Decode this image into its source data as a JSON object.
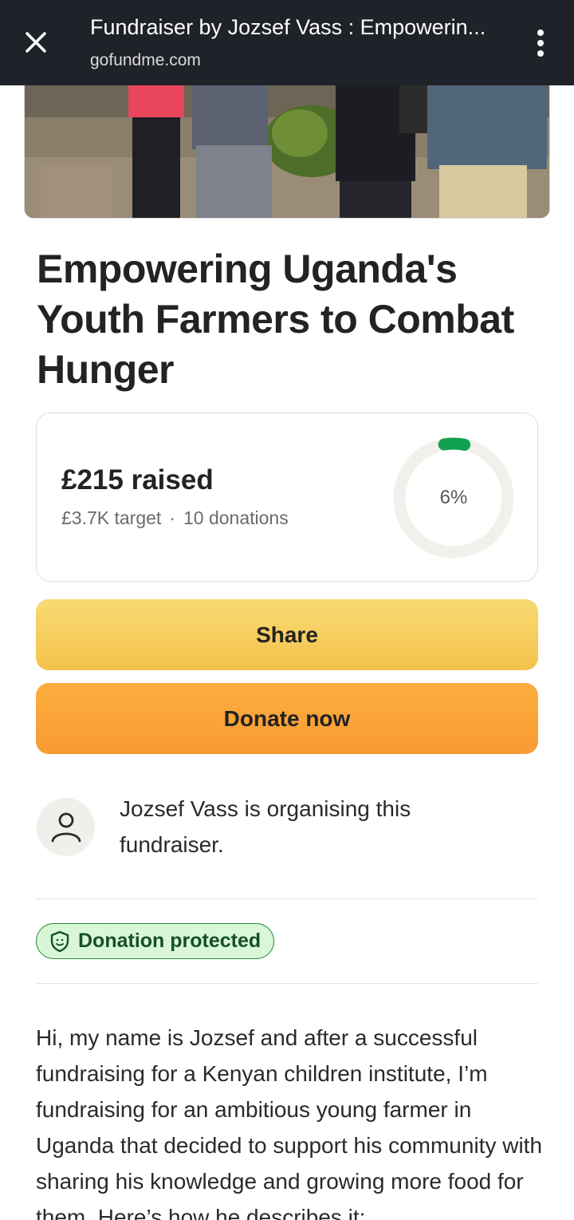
{
  "browser": {
    "title": "Fundraiser by Jozsef Vass : Empowerin...",
    "url": "gofundme.com",
    "close_icon": "close-icon",
    "menu_icon": "more-vertical-icon"
  },
  "campaign": {
    "title": "Empowering Uganda's Youth Farmers to Combat Hunger"
  },
  "progress": {
    "raised": "£215 raised",
    "target": "£3.7K target",
    "separator": "·",
    "donations": "10 donations",
    "percent_label": "6%",
    "percent_value": 6,
    "ring_color": "#12a150",
    "track_color": "#f1f0ea"
  },
  "actions": {
    "share_label": "Share",
    "donate_label": "Donate now"
  },
  "organiser": {
    "text": "Jozsef Vass is organising this fundraiser.",
    "avatar_icon": "user-icon"
  },
  "badge": {
    "label": "Donation protected",
    "icon": "shield-icon"
  },
  "story": {
    "text": "Hi, my name is Jozsef and after a successful fundraising for a Kenyan children institute, I’m fundraising for an ambitious young farmer in Uganda that decided to support his community with sharing his knowledge and growing more food for them. Here’s how he describes it:"
  }
}
